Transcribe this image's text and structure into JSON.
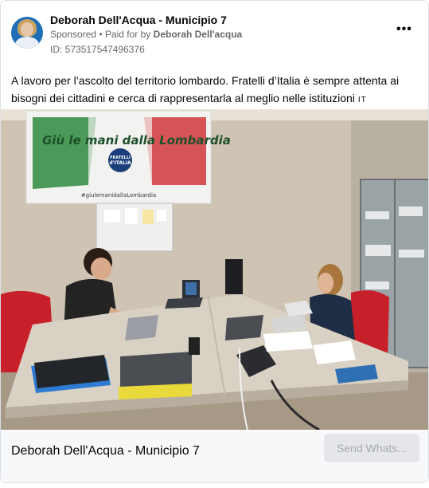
{
  "post": {
    "author": "Deborah Dell'Acqua - Municipio 7",
    "sponsored": "Sponsored",
    "paid_for_prefix": "Paid for by",
    "paid_for_by": "Deborah Dell'acqua",
    "ad_id": "ID: 573517547496376",
    "more_label": "•••",
    "body_text": "A lavoro per l’ascolto del territorio lombardo. Fratelli d’Italia è sempre attenta ai bisogni dei cittadini e cerca di rappresentarla al meglio nelle istituzioni",
    "lang_tag": "IT"
  },
  "photo": {
    "banner_text": "Giù le mani dalla Lombardia",
    "logo_line1": "FRATELLI",
    "logo_line2": "d'ITALIA",
    "hashtag": "#giulemanidallaLombardia",
    "colors": {
      "wall": "#cfc4b3",
      "green": "#2e8b3e",
      "red": "#d2383b",
      "chair": "#c8202a",
      "desk": "#d9d2c4",
      "floor": "#a69a86"
    }
  },
  "footer": {
    "title": "Deborah Dell'Acqua - Municipio 7",
    "cta_label": "Send Whats..."
  }
}
